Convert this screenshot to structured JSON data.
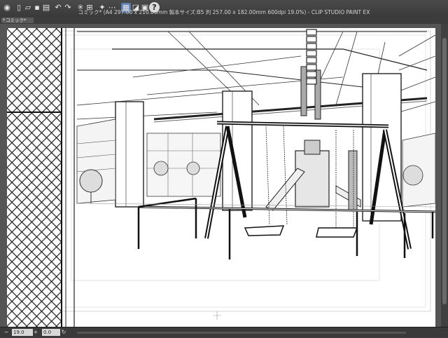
{
  "window": {
    "title": "コミック* (A4 297.00 x 210.00mm 製本サイズ:B5 判 257.00 x 182.00mm 600dpi 19.0%) - CLIP STUDIO PAINT EX"
  },
  "toolbar": {
    "icons": [
      "clip-studio-icon",
      "new-file-icon",
      "open-file-icon",
      "save-icon",
      "print-icon",
      "undo-icon",
      "redo-icon",
      "clear-icon",
      "transform-icon",
      "snap-icon",
      "ruler-snap-icon",
      "grid-snap-icon",
      "perspective-icon",
      "display-icon",
      "help-icon"
    ],
    "help_label": "?"
  },
  "tab": {
    "label": "コミック*",
    "close": "×"
  },
  "status": {
    "zoom": "19.0",
    "angle": "0.0"
  },
  "colors": {
    "chrome": "#3a3a3a",
    "canvas_bg": "#555555",
    "paper": "#ffffff",
    "accent": "#5b7fb0"
  }
}
